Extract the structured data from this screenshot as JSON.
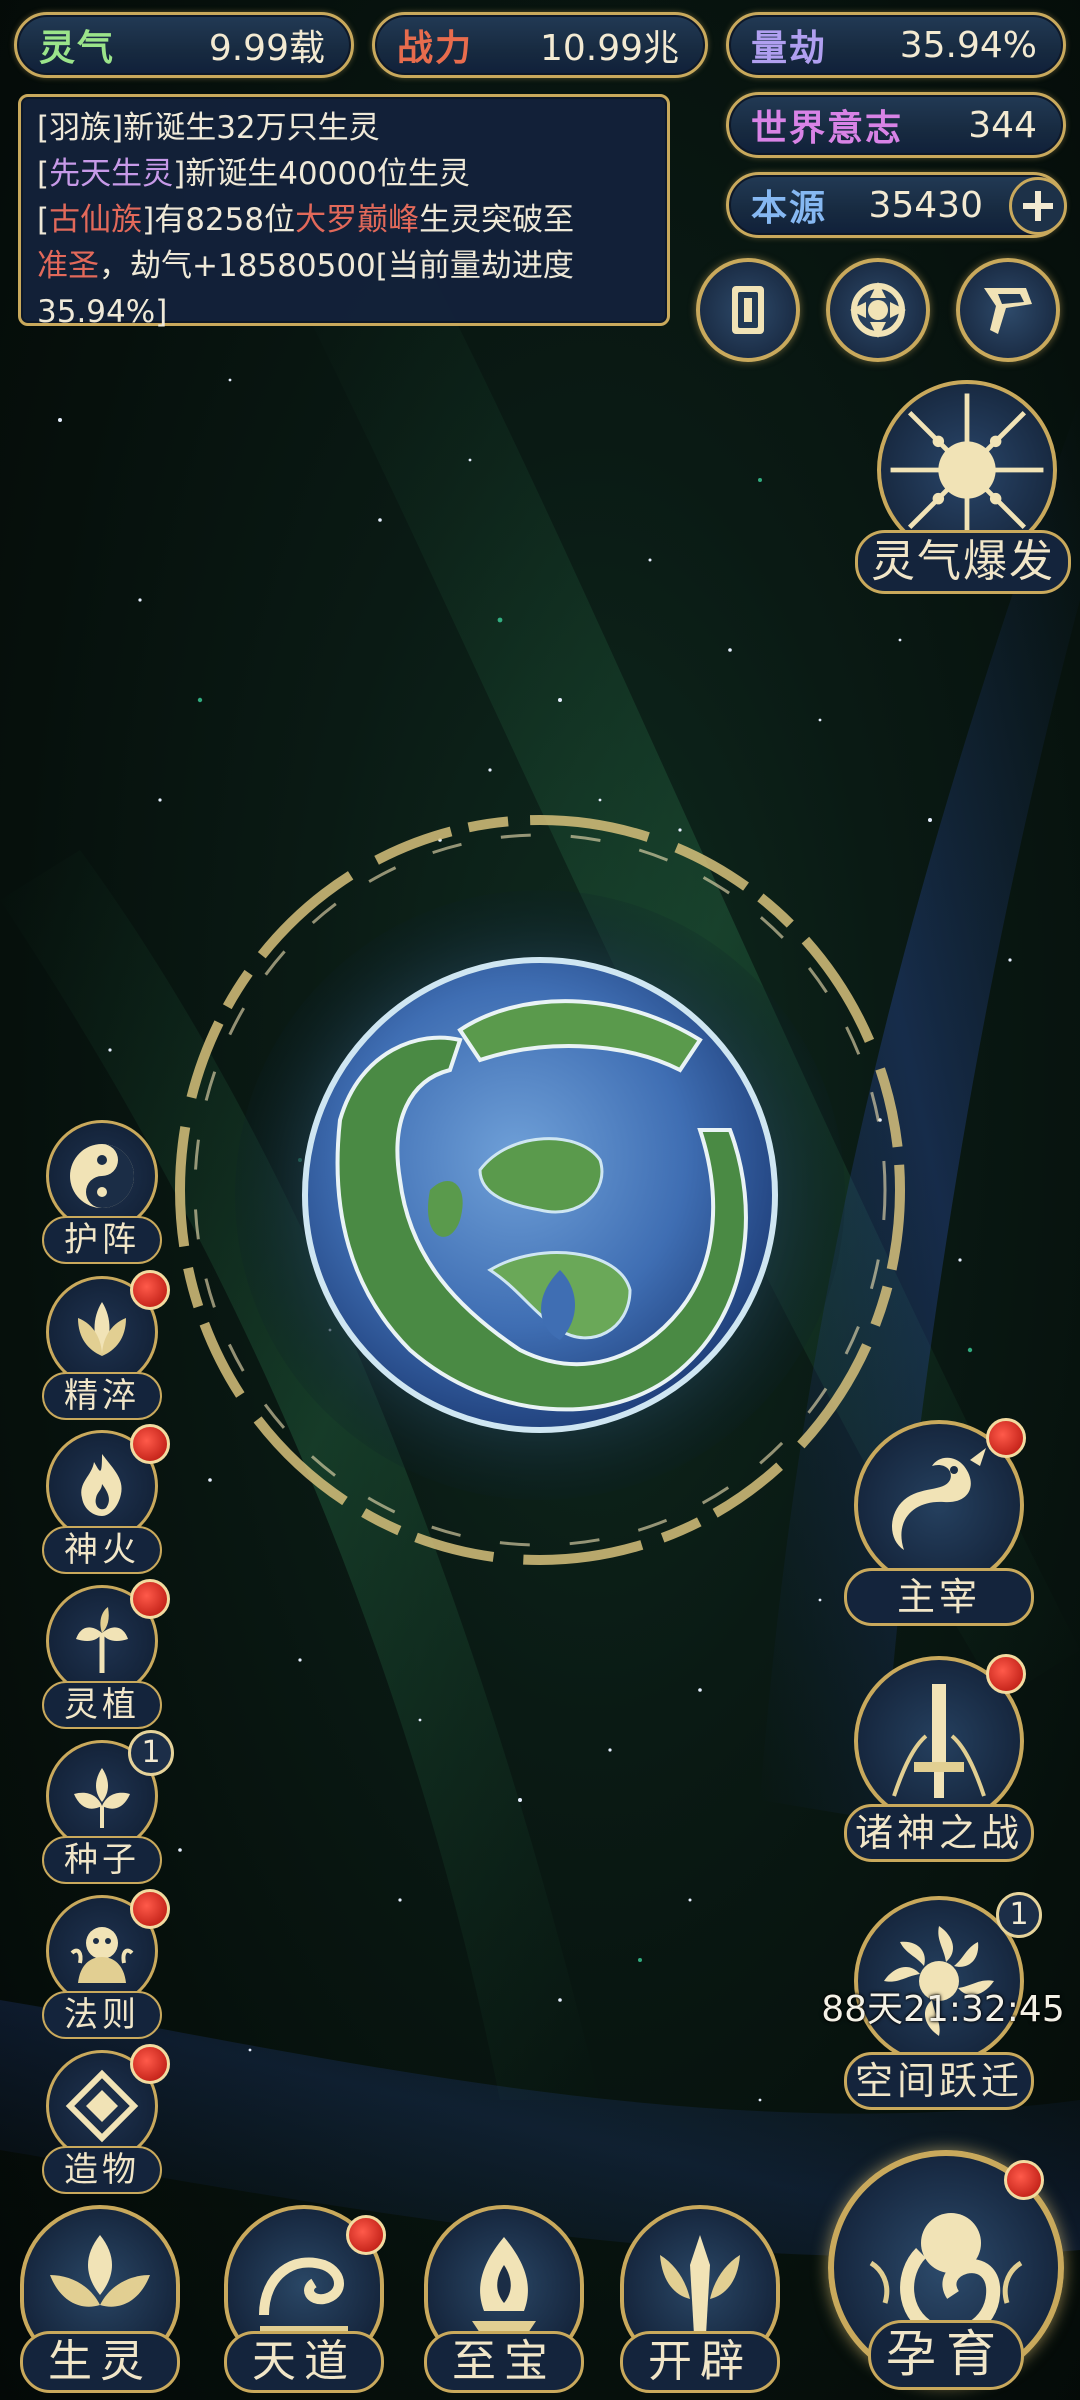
{
  "resources": {
    "lingqi": {
      "label": "灵气",
      "value": "9.99载"
    },
    "zhanli": {
      "label": "战力",
      "value": "10.99兆"
    },
    "liangjie": {
      "label": "量劫",
      "value": "35.94%"
    },
    "shijie": {
      "label": "世界意志",
      "value": "344"
    },
    "benyuan": {
      "label": "本源",
      "value": "35430"
    }
  },
  "log": {
    "line1": "[羽族]新诞生32万只生灵",
    "line2_a": "[",
    "line2_b": "先天生灵",
    "line2_c": "]新诞生40000位生灵",
    "line3_a": "[",
    "line3_b": "古仙族",
    "line3_c": "]有8258位",
    "line3_d": "大罗巅峰",
    "line3_e": "生灵突破至",
    "line4_a": "准圣",
    "line4_b": "，劫气+18580500[当前量劫进度",
    "line5": "35.94%]"
  },
  "top_icons": {
    "card_icon": "card-icon",
    "portal_icon": "portal-icon",
    "flag_icon": "flag-icon"
  },
  "burst": {
    "label": "灵气爆发"
  },
  "left_menu": [
    {
      "label": "护阵",
      "icon": "yin-yang-icon",
      "dot": false
    },
    {
      "label": "精淬",
      "icon": "lotus-icon",
      "dot": true
    },
    {
      "label": "神火",
      "icon": "flame-icon",
      "dot": true
    },
    {
      "label": "灵植",
      "icon": "plant-icon",
      "dot": true
    },
    {
      "label": "种子",
      "icon": "seed-icon",
      "badge": "1"
    },
    {
      "label": "法则",
      "icon": "rule-icon",
      "dot": true
    },
    {
      "label": "造物",
      "icon": "creation-icon",
      "dot": true
    }
  ],
  "right_menu": {
    "zhuzai": {
      "label": "主宰",
      "icon": "dragon-icon"
    },
    "zhushen": {
      "label": "诸神之战",
      "icon": "sword-icon"
    },
    "kongjian": {
      "label": "空间跃迁",
      "icon": "vortex-icon",
      "badge": "1",
      "timer": "88天21:32:45"
    }
  },
  "bottom_nav": {
    "shengling": "生灵",
    "tiandao": "天道",
    "zhibao": "至宝",
    "kaipi": "开辟",
    "yunyu": "孕育"
  },
  "colors": {
    "gold": "#c9a95c",
    "panel": "#14243c",
    "red_dot": "#c8271d"
  }
}
